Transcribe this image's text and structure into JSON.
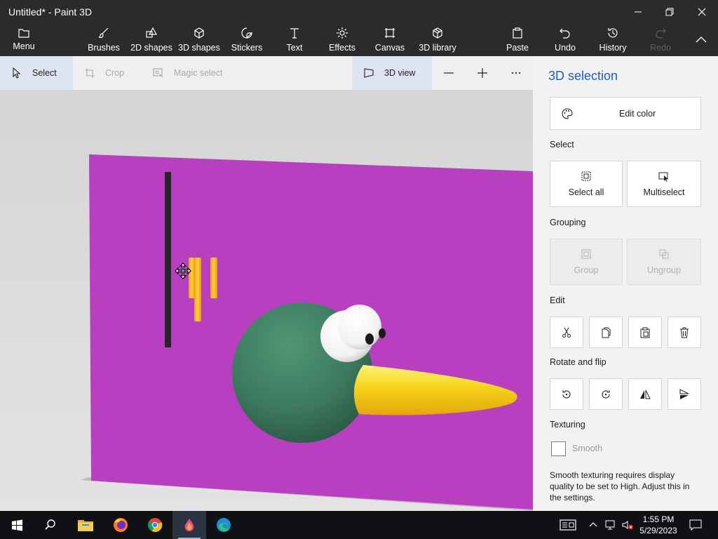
{
  "window": {
    "title": "Untitled* - Paint 3D"
  },
  "toolbar": {
    "menu": "Menu",
    "brushes": "Brushes",
    "shapes2d": "2D shapes",
    "shapes3d": "3D shapes",
    "stickers": "Stickers",
    "text": "Text",
    "effects": "Effects",
    "canvas": "Canvas",
    "library3d": "3D library",
    "paste": "Paste",
    "undo": "Undo",
    "history": "History",
    "redo": "Redo"
  },
  "subbar": {
    "select": "Select",
    "crop": "Crop",
    "magic_select": "Magic select",
    "view3d": "3D view"
  },
  "panel": {
    "title": "3D selection",
    "edit_color": "Edit color",
    "select_heading": "Select",
    "select_all": "Select all",
    "multiselect": "Multiselect",
    "grouping_heading": "Grouping",
    "group": "Group",
    "ungroup": "Ungroup",
    "edit_heading": "Edit",
    "rotate_heading": "Rotate and flip",
    "texturing_heading": "Texturing",
    "smooth": "Smooth",
    "smooth_note": "Smooth texturing requires display quality to be set to High. Adjust this in the settings."
  },
  "taskbar": {
    "time": "1:55 PM",
    "date": "5/29/2023"
  },
  "colors": {
    "accent": "#1d5fb5",
    "canvas_fill": "#b83fbf",
    "sphere": "#3d7a60",
    "beak": "#f4d419",
    "bars": "#f5b81e"
  }
}
